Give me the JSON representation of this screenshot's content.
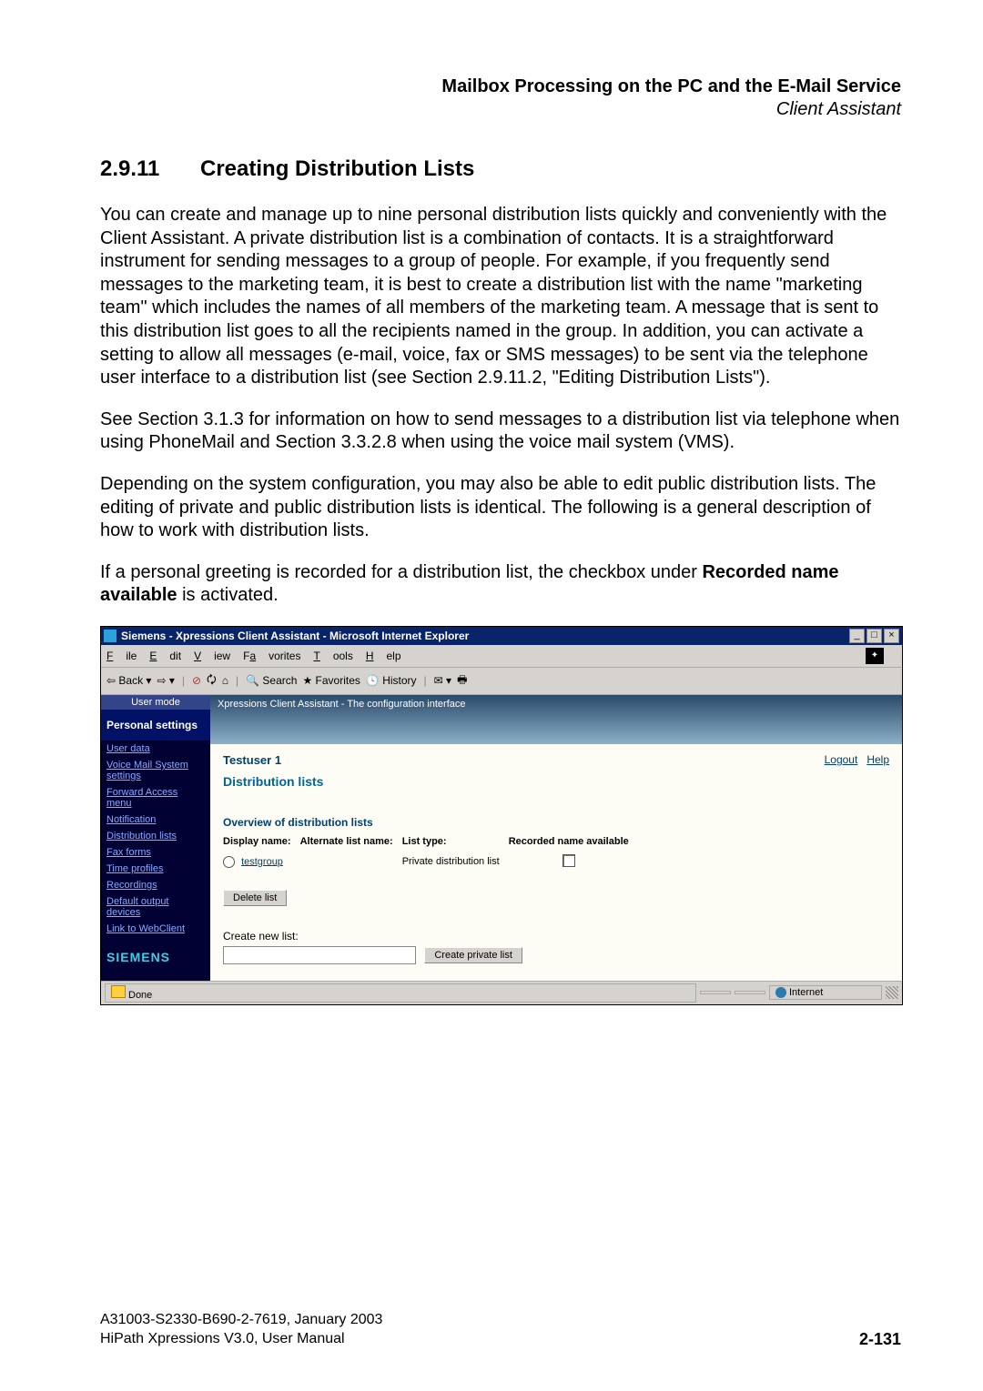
{
  "header": {
    "title_bold": "Mailbox Processing on the PC and the E-Mail Service",
    "title_italic": "Client Assistant"
  },
  "section": {
    "number": "2.9.11",
    "title": "Creating Distribution Lists"
  },
  "paragraphs": {
    "p1": "You can create and manage up to nine personal distribution lists quickly and conveniently with the Client Assistant. A private distribution list is a combination of contacts. It is a straightforward instrument for sending messages to a group of people. For example, if you frequently send messages to the marketing team, it is best to create a distribution list with the name \"marketing team\" which includes the names of all members of the marketing team. A message that is sent to this distribution list goes to all the recipients named in the group. In addition, you can activate a setting to allow all messages (e-mail, voice, fax or SMS messages) to be sent via the telephone user interface to a distribution list (see Section 2.9.11.2, \"Editing Distribution Lists\").",
    "p2": "See Section 3.1.3 for information on how to send messages to a distribution list via telephone when using PhoneMail and Section 3.3.2.8 when using the voice mail system (VMS).",
    "p3": "Depending on the system configuration, you may also be able to edit public distribution lists. The editing of private and public distribution lists is identical. The following is a general description of how to work with distribution lists.",
    "p4a": "If a personal greeting is recorded for a distribution list, the checkbox under ",
    "p4b": "Recorded name available",
    "p4c": " is activated."
  },
  "window": {
    "title": "Siemens - Xpressions Client Assistant - Microsoft Internet Explorer",
    "menus": {
      "file": "File",
      "edit": "Edit",
      "view": "View",
      "favorites": "Favorites",
      "tools": "Tools",
      "help": "Help"
    },
    "toolbar": {
      "back": "Back",
      "search": "Search",
      "favorites": "Favorites",
      "history": "History"
    },
    "sidebar": {
      "user_mode": "User mode",
      "personal_settings": "Personal settings",
      "items": [
        "User data",
        "Voice Mail System settings",
        "Forward Access menu",
        "Notification",
        "Distribution lists",
        "Fax forms",
        "Time profiles",
        "Recordings",
        "Default output devices",
        "Link to WebClient"
      ],
      "brand": "SIEMENS"
    },
    "banner": "Xpressions Client Assistant - The configuration interface",
    "main": {
      "user": "Testuser 1",
      "logout": "Logout",
      "help": "Help",
      "heading": "Distribution lists",
      "overview_title": "Overview of distribution lists",
      "columns": {
        "display": "Display name:",
        "alt": "Alternate list name:",
        "type": "List type:",
        "recorded": "Recorded name available"
      },
      "row": {
        "name": "testgroup",
        "type": "Private distribution list"
      },
      "delete_btn": "Delete list",
      "create_label": "Create new list:",
      "create_btn": "Create private list"
    },
    "status": {
      "done": "Done",
      "zone": "Internet"
    }
  },
  "footer": {
    "line1": "A31003-S2330-B690-2-7619, January 2003",
    "line2": "HiPath Xpressions V3.0, User Manual",
    "page": "2-131"
  }
}
